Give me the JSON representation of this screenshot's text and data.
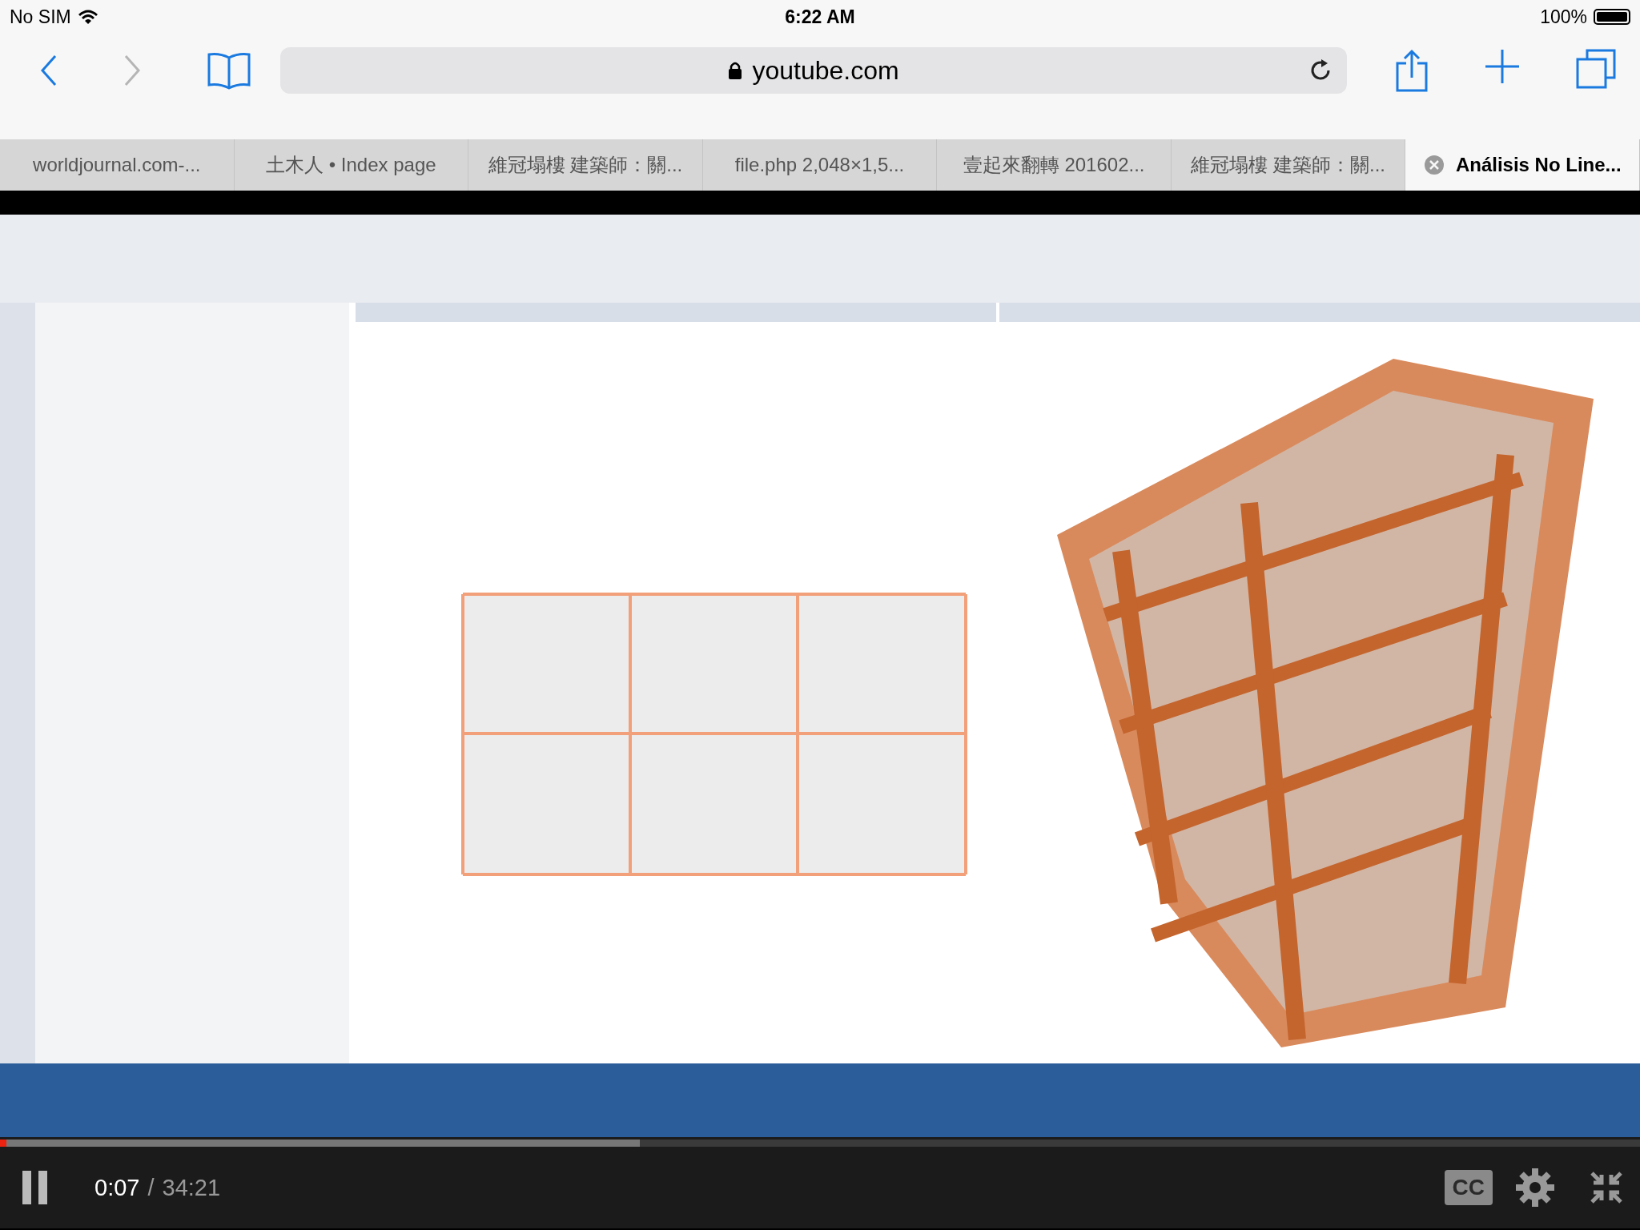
{
  "status_bar": {
    "carrier": "No SIM",
    "time": "6:22 AM",
    "battery": "100%"
  },
  "toolbar": {
    "back_disabled": false,
    "forward_disabled": true,
    "url": "youtube.com"
  },
  "tabs": [
    {
      "title": "worldjournal.com-...",
      "selected": false
    },
    {
      "title": "土木人 • Index page",
      "selected": false
    },
    {
      "title": "維冠塌樓 建築師：關...",
      "selected": false
    },
    {
      "title": "file.php 2,048×1,5...",
      "selected": false
    },
    {
      "title": "壹起來翻轉 201602...",
      "selected": false
    },
    {
      "title": "維冠塌樓 建築師：關...",
      "selected": false
    },
    {
      "title": "Análisis No Line...",
      "selected": true
    }
  ],
  "player": {
    "playing": true,
    "progress": {
      "level": 0.004
    },
    "buffered": {
      "level": 0.39
    },
    "elapsed": "0:07",
    "separator": "/",
    "duration": "34:21",
    "captions": "CC"
  }
}
